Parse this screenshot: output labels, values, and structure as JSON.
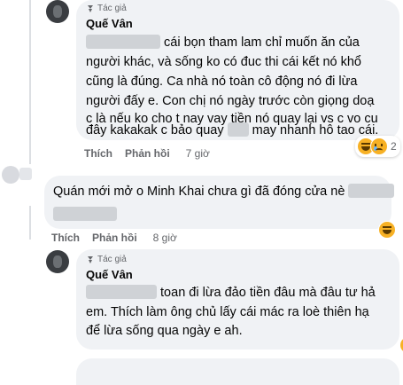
{
  "comment1": {
    "author_badge": "Tác giả",
    "name": "Quế Vân",
    "lines": [
      "cái bọn tham lam chỉ muốn ăn của",
      "người khác, và sống ko có đuc thi cái kết nó khổ",
      "cũng là đúng. Ca nhà nó toàn cô động nó đi lừa",
      "người đấy e. Con chị nó ngày trước còn giọng doạ",
      "c là nếu ko cho t nay vay tiền nó quay lại vs c vo cu",
      "đây kakakak c bảo quay",
      "may nhanh hô tao cái."
    ],
    "reaction_count": "2",
    "actions": {
      "like": "Thích",
      "reply": "Phản hồi",
      "time": "7 giờ"
    }
  },
  "comment2": {
    "text": "Quán mới mở o Minh Khai chưa gì đã đóng cửa nè",
    "actions": {
      "like": "Thích",
      "reply": "Phản hồi",
      "time": "8 giờ"
    }
  },
  "comment3": {
    "author_badge": "Tác giả",
    "name": "Quế Vân",
    "lines": [
      "toan đi lừa đảo tiền đâu mà đâu tư hả",
      "em. Thích làm ông chủ lấy cái mác ra loè thiên hạ",
      "để lừa sống qua ngày e ah."
    ]
  },
  "colors": {
    "bubble": "#f0f2f5",
    "meta": "#65676b",
    "text": "#050505"
  },
  "icons": [
    "author-badge-icon",
    "haha-reaction-icon",
    "sad-reaction-icon"
  ]
}
